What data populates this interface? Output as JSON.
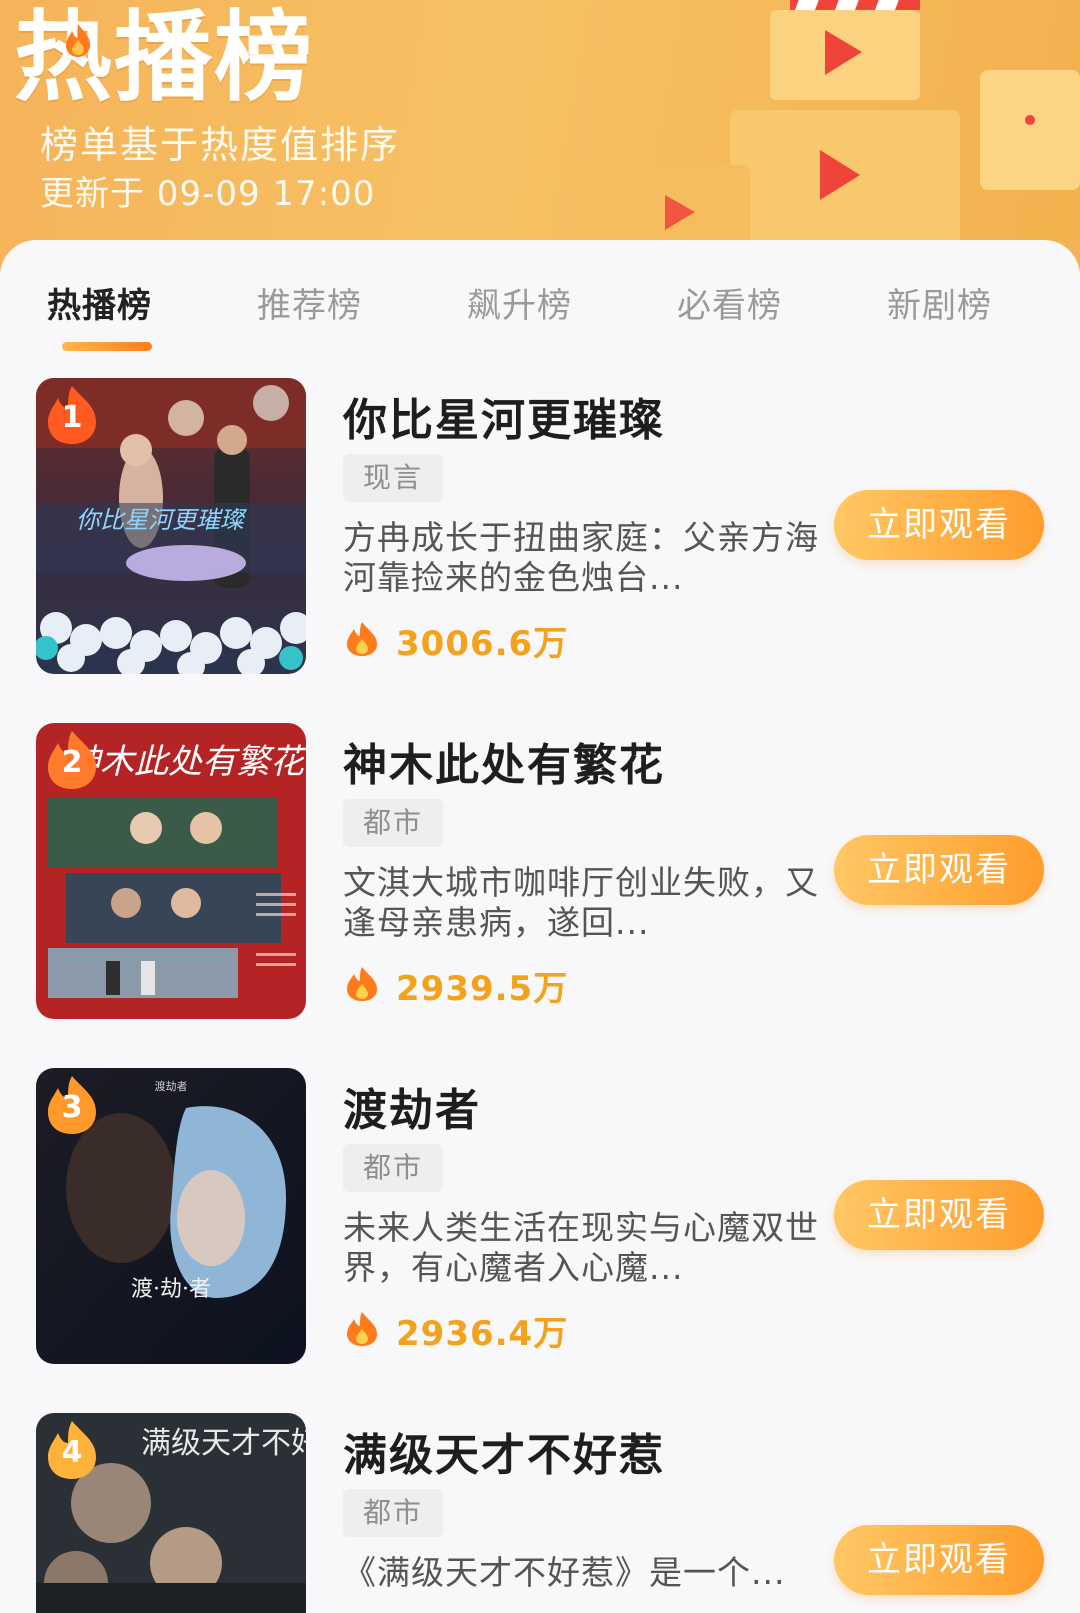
{
  "header": {
    "title": "热播榜",
    "subtitle": "榜单基于热度值排序",
    "update_time": "更新于 09-09 17:00"
  },
  "tabs": [
    {
      "label": "热播榜",
      "active": true
    },
    {
      "label": "推荐榜",
      "active": false
    },
    {
      "label": "飙升榜",
      "active": false
    },
    {
      "label": "必看榜",
      "active": false
    },
    {
      "label": "新剧榜",
      "active": false
    }
  ],
  "items": [
    {
      "rank": "1",
      "title": "你比星河更璀璨",
      "genre": "现言",
      "description": "方冉成长于扭曲家庭：父亲方海河靠捡来的金色烛台...",
      "heat": "3006.6万",
      "button": "立即观看",
      "poster_text": "你比星河更璀璨"
    },
    {
      "rank": "2",
      "title": "神木此处有繁花",
      "genre": "都市",
      "description": "文淇大城市咖啡厅创业失败，又逢母亲患病，遂回...",
      "heat": "2939.5万",
      "button": "立即观看",
      "poster_text": "神木此处有繁花"
    },
    {
      "rank": "3",
      "title": "渡劫者",
      "genre": "都市",
      "description": "未来人类生活在现实与心魔双世界，有心魔者入心魔...",
      "heat": "2936.4万",
      "button": "立即观看",
      "poster_text": "渡·劫·者"
    },
    {
      "rank": "4",
      "title": "满级天才不好惹",
      "genre": "都市",
      "description": "《满级天才不好惹》是一个...",
      "heat": "",
      "button": "立即观看",
      "poster_text": "满级天才不好惹"
    }
  ],
  "colors": {
    "accent": "#ff9d2c",
    "heat": "#f2a21c",
    "header_bg": "#f7c163"
  },
  "icons": {
    "heat": "flame-icon",
    "rank": "flame-badge-icon"
  }
}
